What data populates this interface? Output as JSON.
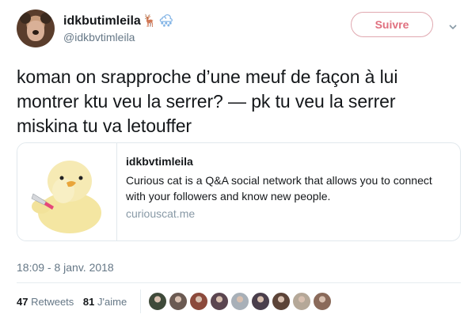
{
  "header": {
    "display_name": "idkbutimleila",
    "emoji_1": "🦌",
    "emoji_2": "🌨",
    "handle": "@idkbvtimleila",
    "follow_label": "Suivre"
  },
  "tweet": {
    "text": "koman on srapproche d’une meuf de façon à lui montrer ktu veu la serrer? — pk tu veu la serrer miskina tu va letouffer"
  },
  "card": {
    "title": "idkbvtimleila",
    "description": "Curious cat is a Q&A social network that allows you to connect with your followers and know new people.",
    "domain": "curiouscat.me",
    "thumbnail": "duck-with-knife"
  },
  "timestamp": "18:09 - 8 janv. 2018",
  "stats": {
    "retweets_count": "47",
    "retweets_label": "Retweets",
    "likes_count": "81",
    "likes_label": "J'aime"
  },
  "likers": [
    {
      "color": "#3f4a3a"
    },
    {
      "color": "#6b5a52"
    },
    {
      "color": "#8c4a3c"
    },
    {
      "color": "#5b4650"
    },
    {
      "color": "#a8b0b8"
    },
    {
      "color": "#4a3f4c"
    },
    {
      "color": "#5c4438"
    },
    {
      "color": "#b5a898"
    },
    {
      "color": "#8a6a5a"
    }
  ],
  "colors": {
    "follow_border": "#e0a8b0",
    "follow_text": "#e0707f",
    "muted": "#657786",
    "card_border": "#e1e8ed"
  }
}
